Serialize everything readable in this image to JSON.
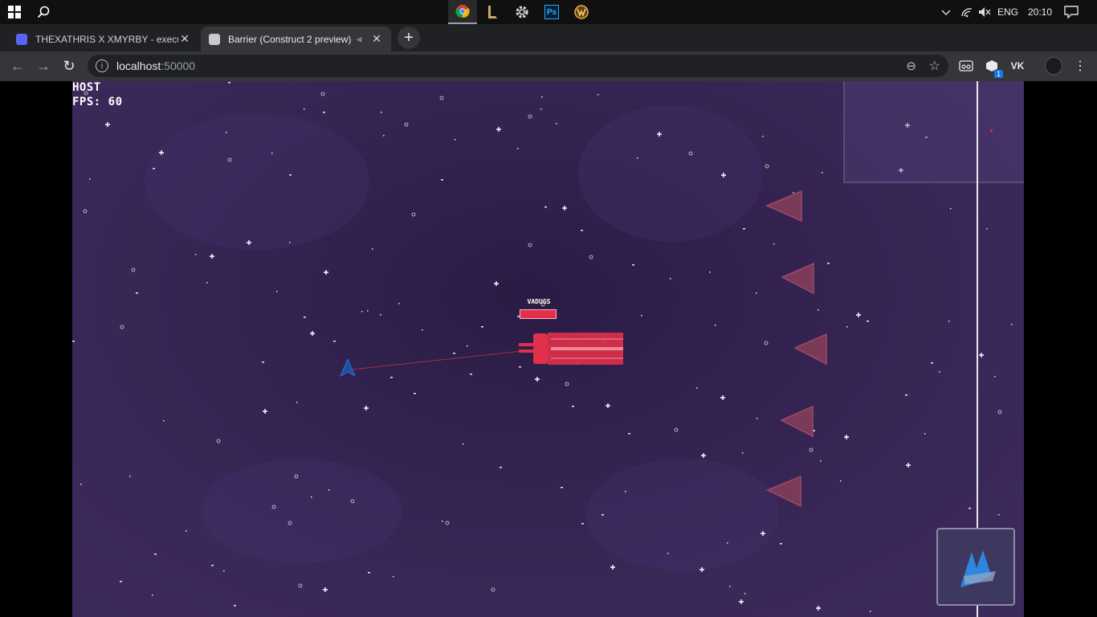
{
  "taskbar": {
    "icons": [
      "windows-start-icon",
      "search-icon"
    ],
    "apps": [
      "chrome-icon",
      "league-icon",
      "settings-gear-icon",
      "photoshop-icon",
      "warcraft-icon"
    ],
    "photoshop_label": "Ps",
    "language": "ENG",
    "time": "20:10"
  },
  "browser": {
    "tabs": [
      {
        "title": "THEXATHRIS X XMYRBY - execute",
        "active": false
      },
      {
        "title": "Barrier (Construct 2 preview)",
        "active": true
      }
    ],
    "url_host": "localhost",
    "url_port": ":50000",
    "extensions": [
      "glasses-ext-icon",
      "cube-ext-icon",
      "vk-ext-icon",
      "avatar-ext-icon"
    ],
    "ext_badge": "1",
    "vk_label": "VK"
  },
  "game": {
    "hud_role": "HOST",
    "hud_fps": "FPS: 60",
    "boss_name": "VADUGS",
    "colors": {
      "space": "#33224f",
      "boss": "#e0304a",
      "player": "#1f4f9e",
      "enemy": "#7a3a58",
      "barrier": "#e8e8f0"
    }
  }
}
